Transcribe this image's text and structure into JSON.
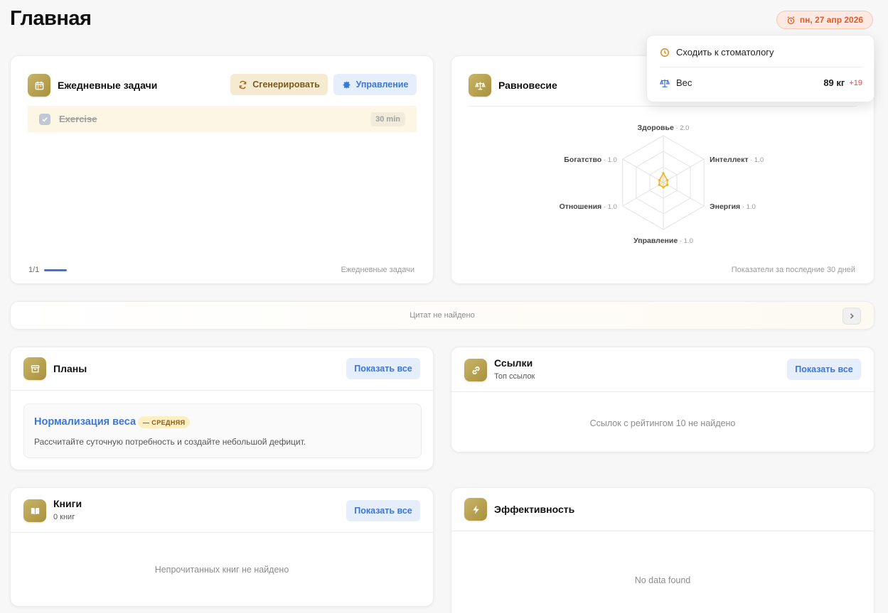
{
  "page": {
    "title": "Главная",
    "date_label": "пн, 27 апр 2026"
  },
  "popover": {
    "reminder_text": "Сходить к стоматологу",
    "weight_label": "Вес",
    "weight_value": "89 кг",
    "weight_delta": "+19"
  },
  "daily_tasks": {
    "title": "Ежедневные задачи",
    "generate_label": "Сгенерировать",
    "manage_label": "Управление",
    "tasks": [
      {
        "name": "Exercise",
        "duration": "30 min",
        "done": true
      }
    ],
    "pagination": "1/1",
    "footer_label": "Ежедневные задачи"
  },
  "balance": {
    "title": "Равновесие",
    "footer_label": "Показатели за последние 30 дней",
    "axes": [
      {
        "label": "Здоровье",
        "value": "2.0"
      },
      {
        "label": "Интеллект",
        "value": "1.0"
      },
      {
        "label": "Энергия",
        "value": "1.0"
      },
      {
        "label": "Управление",
        "value": "1.0"
      },
      {
        "label": "Отношения",
        "value": "1.0"
      },
      {
        "label": "Богатство",
        "value": "1.0"
      }
    ],
    "max_value": 10,
    "accent_color": "#f0b429"
  },
  "quotes": {
    "empty_text": "Цитат не найдено"
  },
  "plans": {
    "title": "Планы",
    "show_all_label": "Показать все",
    "items": [
      {
        "title": "Нормализация веса",
        "priority": "— СРЕДНЯЯ",
        "description": "Рассчитайте суточную потребность и создайте небольшой дефицит."
      }
    ]
  },
  "links": {
    "title": "Ссылки",
    "subtitle": "Топ ссылок",
    "show_all_label": "Показать все",
    "empty_text": "Ссылок с рейтингом 10 не найдено"
  },
  "books": {
    "title": "Книги",
    "subtitle": "0 книг",
    "show_all_label": "Показать все",
    "empty_text": "Непрочитанных книг не найдено"
  },
  "efficiency": {
    "title": "Эффективность",
    "empty_text": "No data found"
  }
}
